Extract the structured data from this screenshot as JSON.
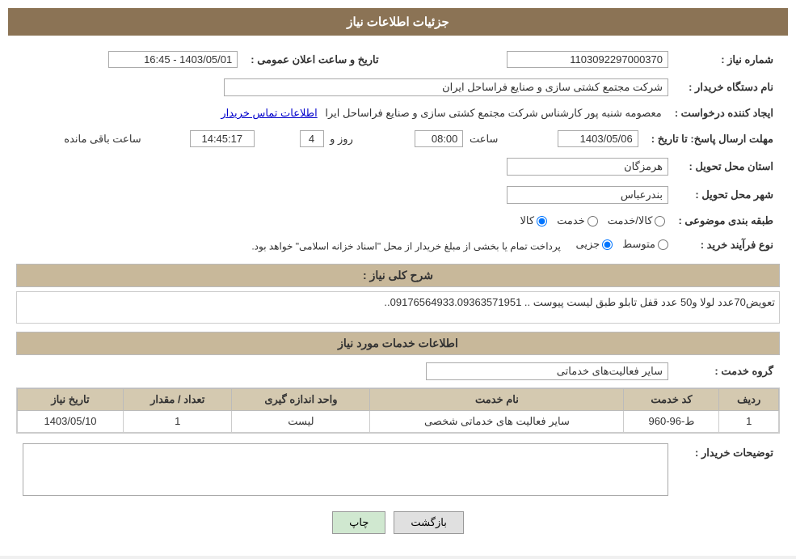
{
  "header": {
    "title": "جزئیات اطلاعات نیاز"
  },
  "fields": {
    "shomare_niaz_label": "شماره نیاز :",
    "shomare_niaz_value": "1103092297000370",
    "naam_dastgah_label": "نام دستگاه خریدار :",
    "naam_dastgah_value": "شرکت مجتمع کشتی سازی و صنایع فراساحل ایران",
    "ijad_konande_label": "ایجاد کننده درخواست :",
    "ijad_konande_value": "معصومه شنبه پور کارشناس شرکت مجتمع کشتی سازی و صنایع فراساحل ایرا",
    "ijad_konande_link": "اطلاعات تماس خریدار",
    "mohlat_label": "مهلت ارسال پاسخ: تا تاریخ :",
    "mohlat_date": "1403/05/06",
    "mohlat_saat": "08:00",
    "mohlat_roz": "4",
    "mohlat_time": "14:45:17",
    "mohlat_mande": "ساعت باقی مانده",
    "ostan_label": "استان محل تحویل :",
    "ostan_value": "هرمزگان",
    "shahr_label": "شهر محل تحویل :",
    "shahr_value": "بندرعباس",
    "tabaqe_label": "طبقه بندی موضوعی :",
    "tabaqe_options": [
      "کالا",
      "خدمت",
      "کالا/خدمت"
    ],
    "tabaqe_selected": "کالا",
    "nooe_farayand_label": "نوع فرآیند خرید :",
    "nooe_farayand_options": [
      "جزیی",
      "متوسط"
    ],
    "nooe_farayand_note": "پرداخت تمام یا بخشی از مبلغ خریدار از محل \"اسناد خزانه اسلامی\" خواهد بود.",
    "sharh_label": "شرح کلی نیاز :",
    "sharh_value": "تعویض70عدد لولا و50 عدد قفل تابلو طبق لیست پیوست .. 09176564933.09363571951..",
    "tarikh_elan_label": "تاریخ و ساعت اعلان عمومی :",
    "tarikh_elan_value": "1403/05/01 - 16:45",
    "khadamat_section": "اطلاعات خدمات مورد نیاز",
    "goroh_khadamat_label": "گروه خدمت :",
    "goroh_khadamat_value": "سایر فعالیت‌های خدماتی",
    "table": {
      "headers": [
        "ردیف",
        "کد خدمت",
        "نام خدمت",
        "واحد اندازه گیری",
        "تعداد / مقدار",
        "تاریخ نیاز"
      ],
      "rows": [
        {
          "radif": "1",
          "kod": "ط-96-960",
          "naam": "سایر فعالیت های خدماتی شخصی",
          "vahed": "لیست",
          "tedaad": "1",
          "tarikh": "1403/05/10"
        }
      ]
    },
    "tosif_label": "توضیحات خریدار :",
    "tosif_value": ""
  },
  "buttons": {
    "print": "چاپ",
    "back": "بازگشت"
  }
}
